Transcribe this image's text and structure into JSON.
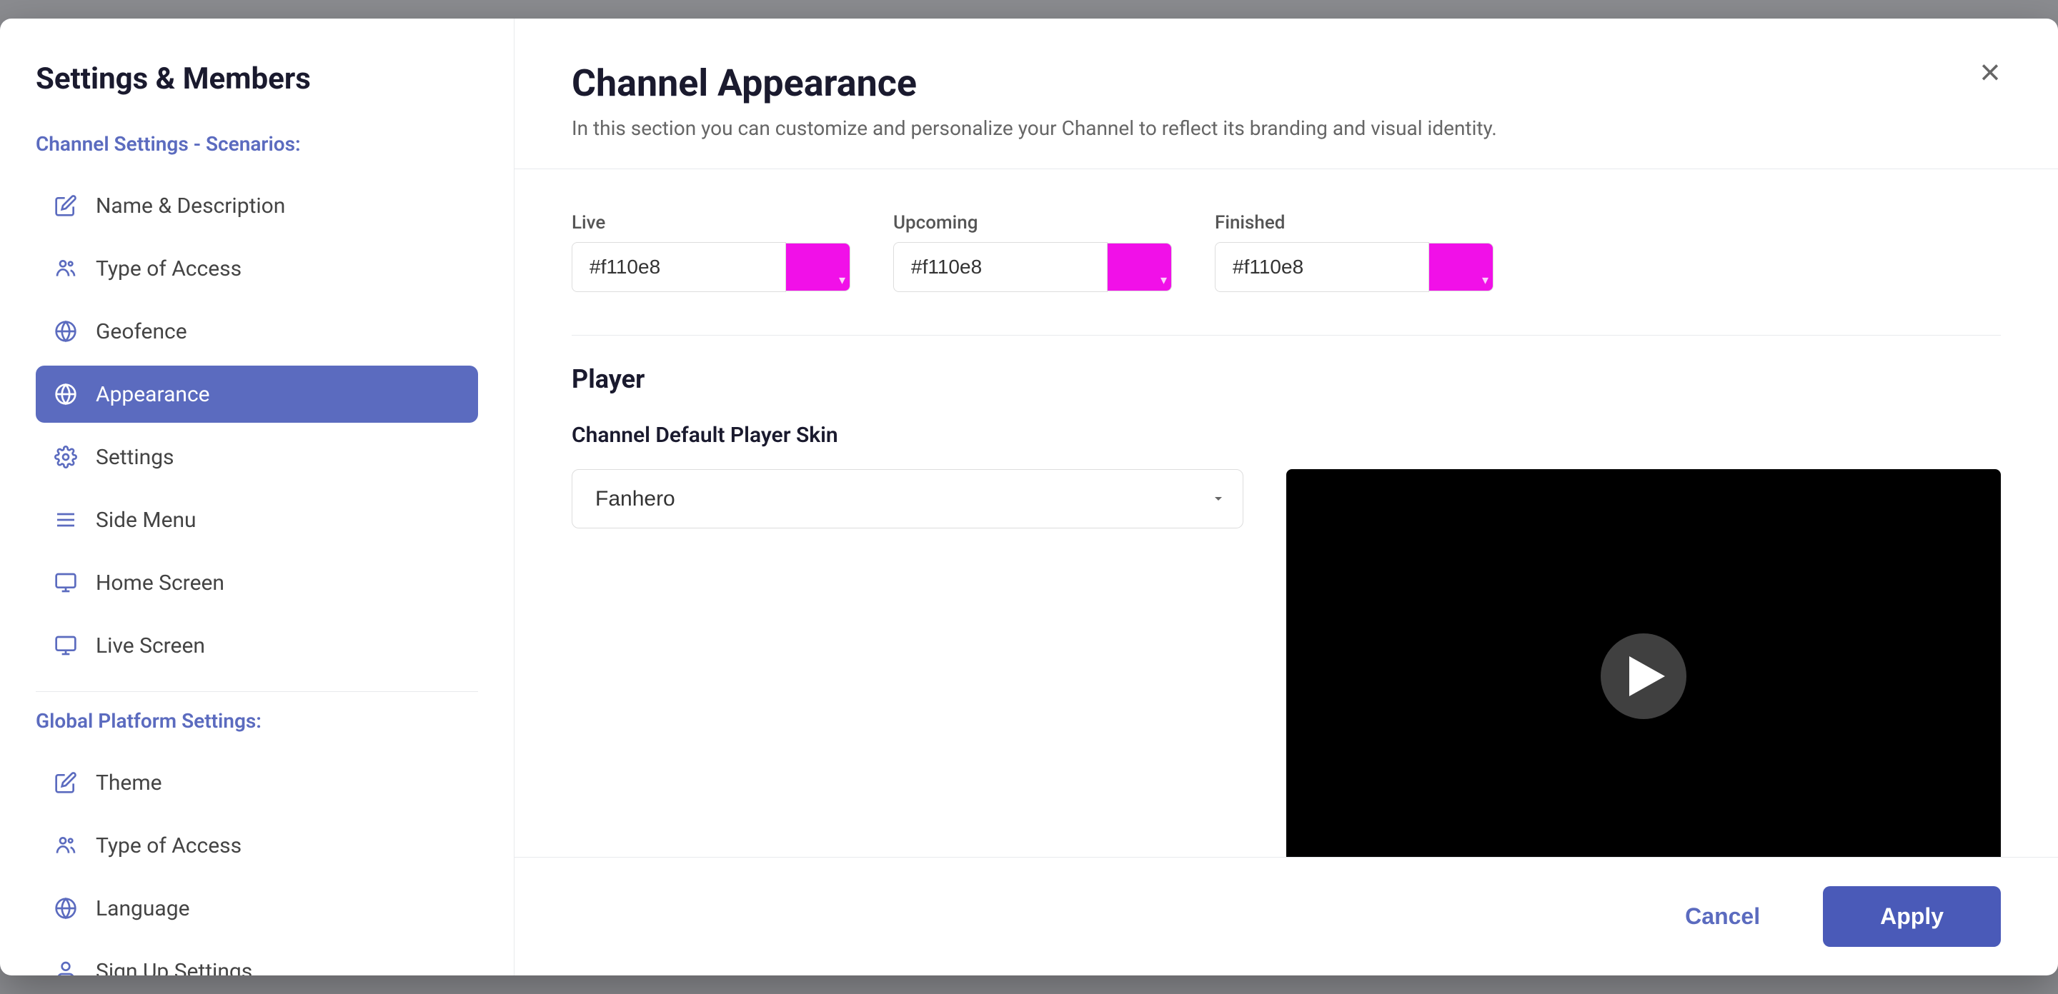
{
  "modal": {
    "title": "Channel Appearance",
    "subtitle": "In this section you can customize and personalize your Channel to reflect its branding and visual identity.",
    "close_label": "×"
  },
  "sidebar": {
    "title": "Settings & Members",
    "channel_section_label": "Channel Settings - Scenarios:",
    "global_section_label": "Global Platform Settings:",
    "items_channel": [
      {
        "id": "name-description",
        "label": "Name & Description",
        "icon": "pencil-icon"
      },
      {
        "id": "type-of-access",
        "label": "Type of Access",
        "icon": "people-icon"
      },
      {
        "id": "geofence",
        "label": "Geofence",
        "icon": "globe-icon"
      },
      {
        "id": "appearance",
        "label": "Appearance",
        "icon": "sphere-icon",
        "active": true
      },
      {
        "id": "settings",
        "label": "Settings",
        "icon": "gear-icon"
      },
      {
        "id": "side-menu",
        "label": "Side Menu",
        "icon": "menu-icon"
      },
      {
        "id": "home-screen",
        "label": "Home Screen",
        "icon": "home-icon"
      },
      {
        "id": "live-screen",
        "label": "Live Screen",
        "icon": "live-icon"
      }
    ],
    "items_global": [
      {
        "id": "theme",
        "label": "Theme",
        "icon": "pencil-icon"
      },
      {
        "id": "type-of-access-global",
        "label": "Type of Access",
        "icon": "people-icon"
      },
      {
        "id": "language",
        "label": "Language",
        "icon": "globe-icon"
      },
      {
        "id": "sign-up-settings",
        "label": "Sign Up Settings",
        "icon": "user-icon"
      }
    ]
  },
  "content": {
    "color_section": {
      "fields": [
        {
          "label": "Live",
          "value": "#f110e8",
          "color": "#f110e8"
        },
        {
          "label": "Upcoming",
          "value": "#f110e8",
          "color": "#f110e8"
        },
        {
          "label": "Finished",
          "value": "#f110e8",
          "color": "#f110e8"
        }
      ]
    },
    "player_section": {
      "heading": "Player",
      "sub_heading": "Channel Default Player Skin",
      "skin_options": [
        "Fanhero"
      ],
      "skin_selected": "Fanhero"
    },
    "footer": {
      "cancel_label": "Cancel",
      "apply_label": "Apply"
    }
  }
}
